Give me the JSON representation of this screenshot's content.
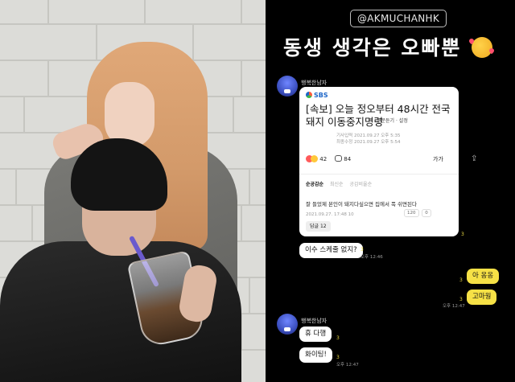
{
  "story": {
    "mention": "@AKMUCHANHK",
    "headline": "동생 생각은 오빠뿐",
    "headline_emoji": "smiling-face-with-hearts-icon"
  },
  "chat": {
    "sender_name": "행복한남자",
    "news_card": {
      "brand": "SBS",
      "title": "[속보] 오늘 정오부터 48시간 전국 돼지 이동중지명령",
      "press": "본문듣기 · 설정",
      "input_date": "기사입력 2021.09.27 오후 5:35",
      "edit_date": "최종수정 2021.09.27 오후 5:54",
      "reaction_count": "42",
      "comment_count": "84",
      "font_button": "가가",
      "tabs": [
        "순공감순",
        "최신순",
        "공감비율순"
      ],
      "comment_text": "잘 들었제 본인이 돼지다싶으면 집에서 푹 쉬면된다",
      "comment_meta": "2021.09.27. 17:48 10",
      "like_counts": [
        "120",
        "0"
      ],
      "reply_label": "답글 12"
    },
    "messages_in_1": {
      "text": "이수 스케줄 없지?",
      "count": "3",
      "time": "오후 12:46"
    },
    "messages_out": [
      {
        "text": "아 옹옹",
        "count": "3"
      },
      {
        "text": "고마웡",
        "count": "3",
        "time": "오후 12:47"
      }
    ],
    "card_count": "3",
    "messages_in_2": [
      {
        "text": "휴 다행",
        "count": "3"
      },
      {
        "text": "화이팅!",
        "count": "3",
        "time": "오후 12:47"
      }
    ]
  },
  "colors": {
    "background": "#000000",
    "outgoing_bubble": "#f6e146",
    "incoming_bubble": "#ffffff",
    "unread_count": "#e9d843"
  }
}
